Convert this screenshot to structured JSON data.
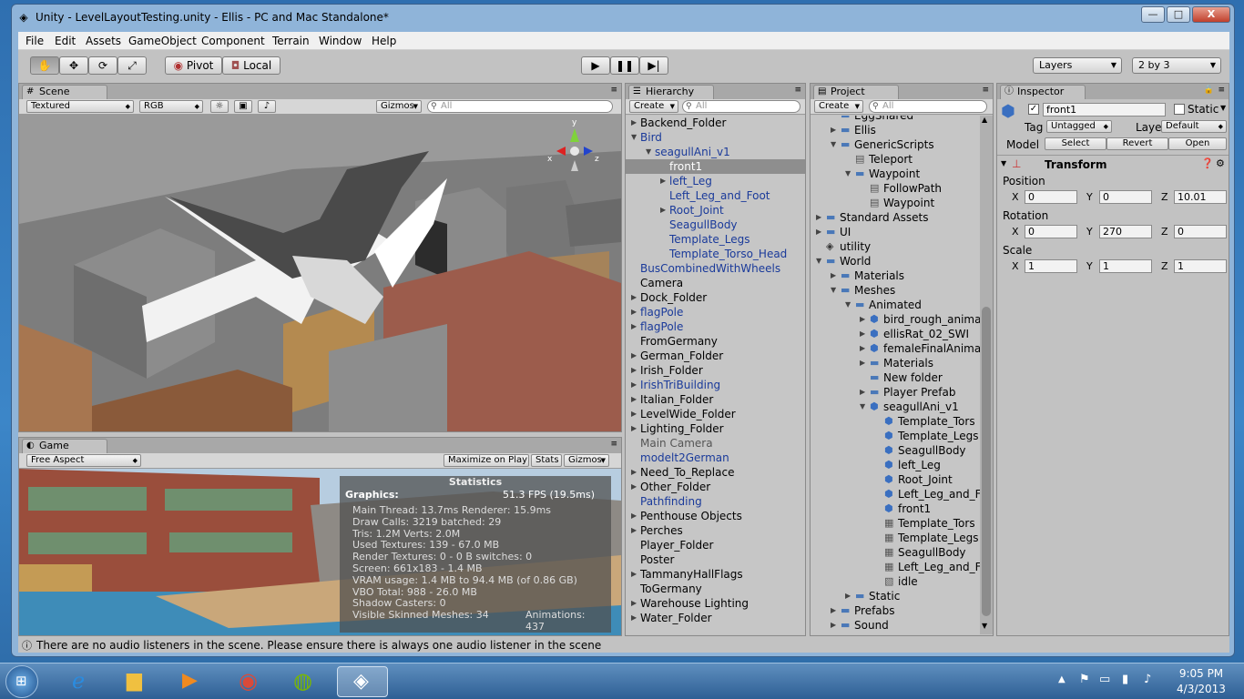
{
  "window": {
    "title": "Unity - LevelLayoutTesting.unity - Ellis - PC and Mac Standalone*"
  },
  "titlebar_buttons": {
    "minimize": "—",
    "maximize": "□",
    "close": "X"
  },
  "menu": [
    "File",
    "Edit",
    "Assets",
    "GameObject",
    "Component",
    "Terrain",
    "Window",
    "Help"
  ],
  "toolbar": {
    "pivot": "Pivot",
    "local": "Local",
    "layers": "Layers",
    "layout": "2 by 3"
  },
  "scene": {
    "tab": "Scene",
    "draw_mode": "Textured",
    "render_mode": "RGB",
    "gizmos": "Gizmos",
    "search": "All",
    "axes": {
      "y": "y",
      "x": "x",
      "z": "z"
    }
  },
  "game": {
    "tab": "Game",
    "aspect": "Free Aspect",
    "maximize": "Maximize on Play",
    "stats": "Stats",
    "gizmos": "Gizmos"
  },
  "statistics": {
    "title": "Statistics",
    "graphics_label": "Graphics:",
    "fps": "51.3 FPS (19.5ms)",
    "lines": [
      "Main Thread: 13.7ms  Renderer: 15.9ms",
      "Draw Calls: 3219  batched: 29",
      "Tris: 1.2M    Verts: 2.0M",
      "Used Textures: 139 - 67.0 MB",
      "Render Textures: 0 - 0 B  switches: 0",
      "Screen: 661x183 - 1.4 MB",
      "VRAM usage: 1.4 MB to 94.4 MB (of 0.86 GB)",
      "VBO Total: 988 - 26.0 MB",
      "Shadow Casters: 0"
    ],
    "skinned": "Visible Skinned Meshes: 34",
    "animations": "Animations: 437"
  },
  "hierarchy": {
    "tab": "Hierarchy",
    "create": "Create",
    "search": "All",
    "items": [
      {
        "label": "Backend_Folder",
        "fold": "▶",
        "color": "black"
      },
      {
        "label": "Bird",
        "fold": "▼",
        "color": "blue"
      },
      {
        "label": "seagullAni_v1",
        "fold": "▼",
        "color": "blue"
      },
      {
        "label": "front1",
        "fold": "",
        "color": "selected"
      },
      {
        "label": "left_Leg",
        "fold": "▶",
        "color": "blue"
      },
      {
        "label": "Left_Leg_and_Foot",
        "fold": "",
        "color": "blue"
      },
      {
        "label": "Root_Joint",
        "fold": "▶",
        "color": "blue"
      },
      {
        "label": "SeagullBody",
        "fold": "",
        "color": "blue"
      },
      {
        "label": "Template_Legs",
        "fold": "",
        "color": "blue"
      },
      {
        "label": "Template_Torso_Head",
        "fold": "",
        "color": "blue"
      },
      {
        "label": "BusCombinedWithWheels",
        "fold": "",
        "color": "blue"
      },
      {
        "label": "Camera",
        "fold": "",
        "color": "black"
      },
      {
        "label": "Dock_Folder",
        "fold": "▶",
        "color": "black"
      },
      {
        "label": "flagPole",
        "fold": "▶",
        "color": "blue"
      },
      {
        "label": "flagPole",
        "fold": "▶",
        "color": "blue"
      },
      {
        "label": "FromGermany",
        "fold": "",
        "color": "black"
      },
      {
        "label": "German_Folder",
        "fold": "▶",
        "color": "black"
      },
      {
        "label": "Irish_Folder",
        "fold": "▶",
        "color": "black"
      },
      {
        "label": "IrishTriBuilding",
        "fold": "▶",
        "color": "blue"
      },
      {
        "label": "Italian_Folder",
        "fold": "▶",
        "color": "black"
      },
      {
        "label": "LevelWide_Folder",
        "fold": "▶",
        "color": "black"
      },
      {
        "label": "Lighting_Folder",
        "fold": "▶",
        "color": "black"
      },
      {
        "label": "Main Camera",
        "fold": "",
        "color": "gray"
      },
      {
        "label": "modelt2German",
        "fold": "",
        "color": "blue"
      },
      {
        "label": "Need_To_Replace",
        "fold": "▶",
        "color": "black"
      },
      {
        "label": "Other_Folder",
        "fold": "▶",
        "color": "black"
      },
      {
        "label": "Pathfinding",
        "fold": "",
        "color": "blue"
      },
      {
        "label": "Penthouse Objects",
        "fold": "▶",
        "color": "black"
      },
      {
        "label": "Perches",
        "fold": "▶",
        "color": "black"
      },
      {
        "label": "Player_Folder",
        "fold": "",
        "color": "black"
      },
      {
        "label": "Poster",
        "fold": "",
        "color": "black"
      },
      {
        "label": "TammanyHallFlags",
        "fold": "▶",
        "color": "black"
      },
      {
        "label": "ToGermany",
        "fold": "",
        "color": "black"
      },
      {
        "label": "Warehouse Lighting",
        "fold": "▶",
        "color": "black"
      },
      {
        "label": "Water_Folder",
        "fold": "▶",
        "color": "black"
      }
    ]
  },
  "project": {
    "tab": "Project",
    "create": "Create",
    "search": "All",
    "items": [
      {
        "label": "EggShared",
        "fold": "",
        "icon": "folder"
      },
      {
        "label": "Ellis",
        "fold": "▶",
        "icon": "folder"
      },
      {
        "label": "GenericScripts",
        "fold": "▼",
        "icon": "folder"
      },
      {
        "label": "Teleport",
        "fold": "",
        "icon": "script"
      },
      {
        "label": "Waypoint",
        "fold": "▼",
        "icon": "folder"
      },
      {
        "label": "FollowPath",
        "fold": "",
        "icon": "script"
      },
      {
        "label": "Waypoint",
        "fold": "",
        "icon": "script"
      },
      {
        "label": "Standard Assets",
        "fold": "▶",
        "icon": "folder"
      },
      {
        "label": "UI",
        "fold": "▶",
        "icon": "folder"
      },
      {
        "label": "utility",
        "fold": "",
        "icon": "unity"
      },
      {
        "label": "World",
        "fold": "▼",
        "icon": "folder"
      },
      {
        "label": "Materials",
        "fold": "▶",
        "icon": "folder"
      },
      {
        "label": "Meshes",
        "fold": "▼",
        "icon": "folder"
      },
      {
        "label": "Animated",
        "fold": "▼",
        "icon": "folder"
      },
      {
        "label": "bird_rough_anima",
        "fold": "▶",
        "icon": "prefab"
      },
      {
        "label": "ellisRat_02_SWI",
        "fold": "▶",
        "icon": "prefab"
      },
      {
        "label": "femaleFinalAnima",
        "fold": "▶",
        "icon": "prefab"
      },
      {
        "label": "Materials",
        "fold": "▶",
        "icon": "folder"
      },
      {
        "label": "New folder",
        "fold": "",
        "icon": "folder"
      },
      {
        "label": "Player Prefab",
        "fold": "▶",
        "icon": "folder"
      },
      {
        "label": "seagullAni_v1",
        "fold": "▼",
        "icon": "prefab"
      },
      {
        "label": "Template_Tors",
        "fold": "",
        "icon": "mesh"
      },
      {
        "label": "Template_Legs",
        "fold": "",
        "icon": "mesh"
      },
      {
        "label": "SeagullBody",
        "fold": "",
        "icon": "mesh"
      },
      {
        "label": "left_Leg",
        "fold": "",
        "icon": "mesh"
      },
      {
        "label": "Root_Joint",
        "fold": "",
        "icon": "mesh"
      },
      {
        "label": "Left_Leg_and_F",
        "fold": "",
        "icon": "mesh"
      },
      {
        "label": "front1",
        "fold": "",
        "icon": "mesh"
      },
      {
        "label": "Template_Tors",
        "fold": "",
        "icon": "grid"
      },
      {
        "label": "Template_Legs",
        "fold": "",
        "icon": "grid"
      },
      {
        "label": "SeagullBody",
        "fold": "",
        "icon": "grid"
      },
      {
        "label": "Left_Leg_and_F",
        "fold": "",
        "icon": "grid"
      },
      {
        "label": "idle",
        "fold": "",
        "icon": "anim"
      },
      {
        "label": "Static",
        "fold": "▶",
        "icon": "folder"
      },
      {
        "label": "Prefabs",
        "fold": "▶",
        "icon": "folder"
      },
      {
        "label": "Sound",
        "fold": "▶",
        "icon": "folder"
      }
    ]
  },
  "inspector": {
    "tab": "Inspector",
    "name": "front1",
    "static": "Static",
    "tag_label": "Tag",
    "tag": "Untagged",
    "layer_label": "Layer",
    "layer": "Default",
    "model_label": "Model",
    "select": "Select",
    "revert": "Revert",
    "open": "Open",
    "transform": "Transform",
    "position_label": "Position",
    "rotation_label": "Rotation",
    "scale_label": "Scale",
    "x": "X",
    "y": "Y",
    "z": "Z",
    "position": {
      "x": "0",
      "y": "0",
      "z": "10.01"
    },
    "rotation": {
      "x": "0",
      "y": "270",
      "z": "0"
    },
    "scale": {
      "x": "1",
      "y": "1",
      "z": "1"
    }
  },
  "status": "There are no audio listeners in the scene. Please ensure there is always one audio listener in the scene",
  "taskbar": {
    "time": "9:05 PM",
    "date": "4/3/2013"
  },
  "colors": {
    "selection": "#8e8e8e",
    "link_blue": "#1a3a9a",
    "panel": "#c2c2c2"
  }
}
